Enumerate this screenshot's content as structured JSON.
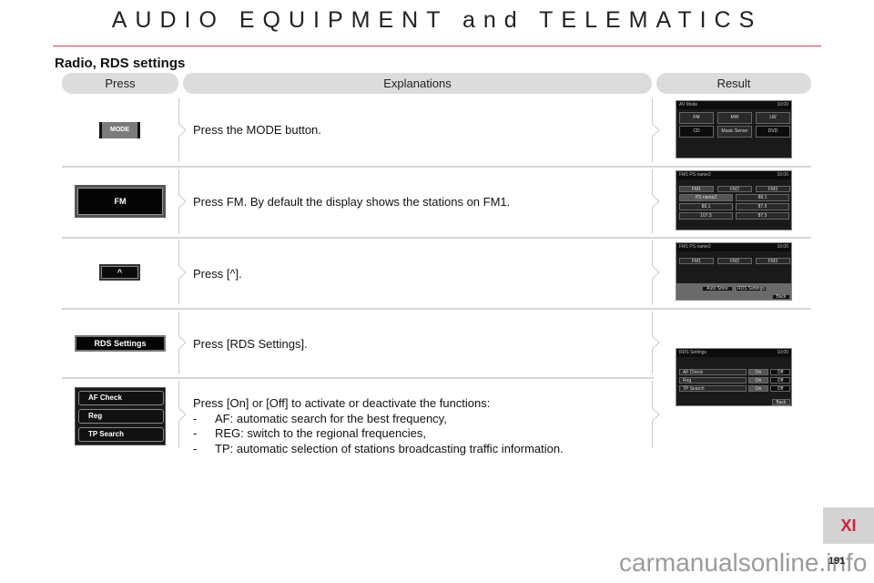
{
  "header": {
    "title": "AUDIO EQUIPMENT and TELEMATICS"
  },
  "section": {
    "title": "Radio, RDS settings"
  },
  "columns": {
    "press": "Press",
    "explanations": "Explanations",
    "result": "Result"
  },
  "rows": [
    {
      "button_label": "MODE",
      "explanation": "Press the MODE button.",
      "result_screen": {
        "title": "AV Mode",
        "clock": "10:00",
        "buttons": [
          "FM",
          "MW",
          "LW",
          "CD",
          "Music Server",
          "DVD"
        ]
      }
    },
    {
      "button_label": "FM",
      "explanation": "Press FM. By default the display shows the stations on FM1.",
      "result_screen": {
        "title": "FM1  PS name2",
        "clock": "10:00",
        "tabs": [
          "FM1",
          "FM2",
          "FM3"
        ],
        "presets": [
          "PS name2",
          "88.1",
          "88.1",
          "87.5",
          "107.5",
          "87.5"
        ]
      }
    },
    {
      "button_label": "^",
      "explanation": "Press [^].",
      "result_screen": {
        "title": "FM1  PS name2",
        "clock": "10:00",
        "tabs": [
          "FM1",
          "FM2",
          "FM3"
        ],
        "buttons": [
          "Auto Store",
          "RDS Settings"
        ],
        "back": "Back"
      }
    },
    {
      "button_label": "RDS Settings",
      "explanation": "Press [RDS Settings].",
      "result_screen": {
        "title": "RDS Settings",
        "clock": "10:00",
        "options": [
          "AF Check",
          "Reg",
          "TP Search"
        ],
        "on": "On",
        "off": "Off",
        "back": "Back"
      }
    },
    {
      "button_labels": [
        "AF Check",
        "Reg",
        "TP Search"
      ],
      "explanation": "Press [On] or [Off] to activate or deactivate the functions:",
      "bullets": [
        "AF: automatic search for the best frequency,",
        "REG: switch to the regional frequencies,",
        "TP: automatic selection of stations broadcasting traffic information."
      ]
    }
  ],
  "chapter_tab": "XI",
  "page_number": "191",
  "watermark": "carmanualsonline.info",
  "colors": {
    "accent_rule": "#d8404f",
    "chapter": "#d81f3a",
    "header_bg": "#dcdcdc"
  }
}
